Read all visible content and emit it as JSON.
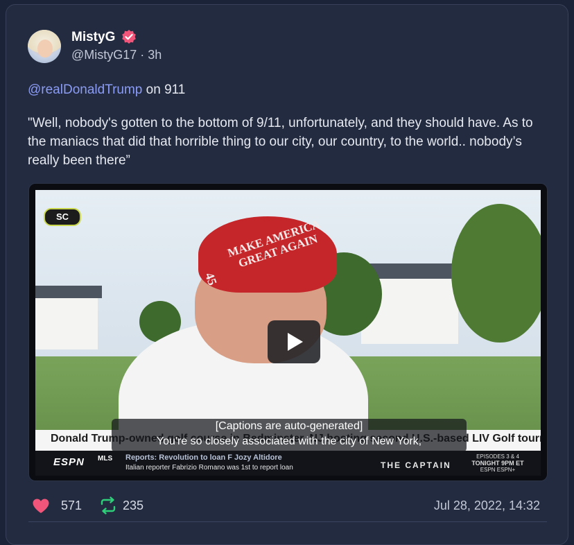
{
  "post": {
    "author_name": "MistyG",
    "handle": "@MistyG17",
    "separator": "·",
    "time_ago": "3h",
    "mention": "@realDonaldTrump",
    "mention_suffix": "on 911",
    "quote": "\"Well, nobody's gotten to the bottom of 9/11, unfortunately, and they should have. As to the maniacs that did that horrible thing to our city, our country, to the world.. nobody’s really been there”",
    "likes": "571",
    "reposts": "235",
    "date": "Jul 28, 2022, 14:32"
  },
  "video": {
    "channel_logo": "SC",
    "hat_text": "MAKE AMERICA GREAT AGAIN",
    "hat_number": "45",
    "lower_third": "Donald Trump-owned golf course in Bedminster, NJ hosting second U.S.-based LIV Golf tournament_|",
    "captions_line1": "[Captions are auto-generated]",
    "captions_line2": "You're so closely associated with the city of New York,",
    "network": "ESPN",
    "ticker_label": "MLS",
    "ticker_headline": "Reports: Revolution to loan F Jozy Altidore",
    "ticker_sub": "Italian reporter Fabrizio Romano was 1st to report loan",
    "promo_title": "THE CAPTAIN",
    "promo_line1": "EPISODES 3 & 4",
    "promo_line2": "TONIGHT 9PM ET",
    "promo_line3": "ESPN ESPN+"
  },
  "colors": {
    "background": "#1b2338",
    "card": "#232b40",
    "mention": "#8b9cf4",
    "heart": "#f2557a",
    "repost": "#2fcf7a",
    "verified": "#f2557a"
  },
  "icons": [
    "verified-badge-icon",
    "play-icon",
    "heart-icon",
    "repost-icon"
  ]
}
